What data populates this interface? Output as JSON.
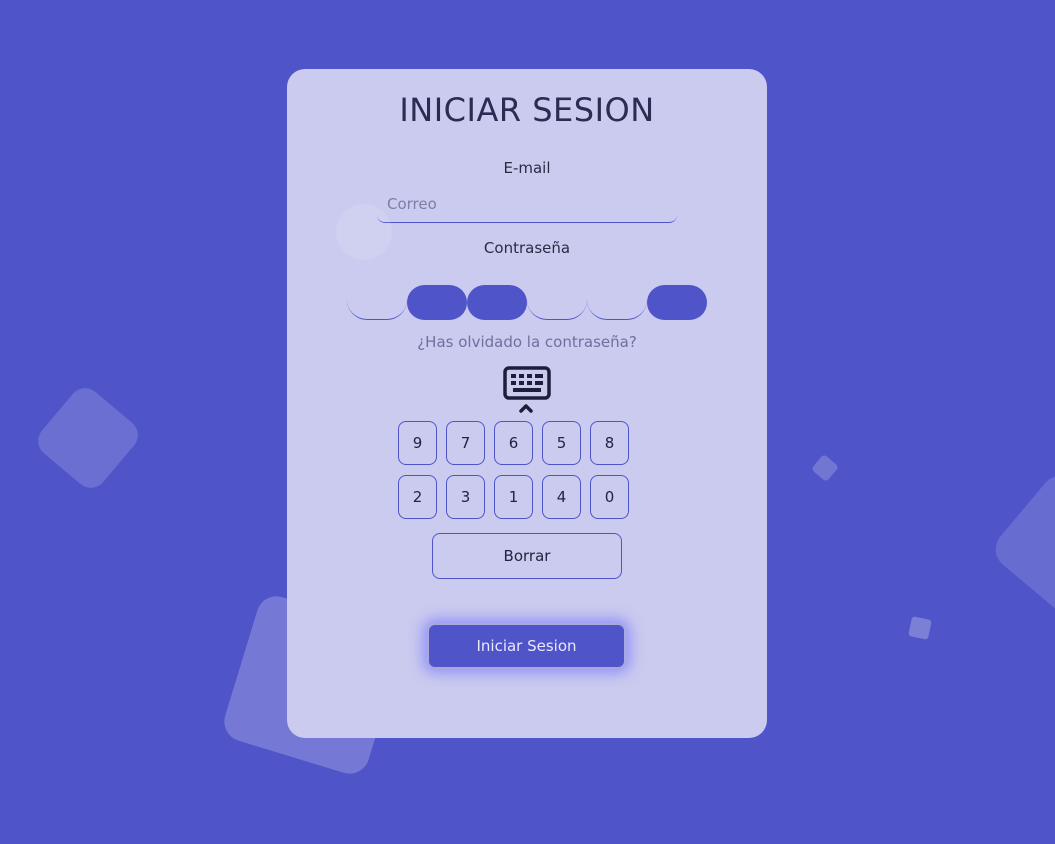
{
  "colors": {
    "background": "#4f54c9",
    "card": "#cbcbef",
    "accent": "#4f54c9",
    "title_text": "#2a2c54"
  },
  "login": {
    "title": "INICIAR SESION",
    "email_label": "E-mail",
    "email_placeholder": "Correo",
    "email_value": "",
    "password_label": "Contraseña",
    "pin_slots": [
      false,
      true,
      true,
      false,
      false,
      true
    ],
    "forgot_link": "¿Has olvidado la contraseña?",
    "keyboard_icon": "keyboard-icon",
    "keypad_rows": [
      [
        "9",
        "7",
        "6",
        "5",
        "8"
      ],
      [
        "2",
        "3",
        "1",
        "4",
        "0"
      ]
    ],
    "clear_label": "Borrar",
    "submit_label": "Iniciar Sesion"
  }
}
